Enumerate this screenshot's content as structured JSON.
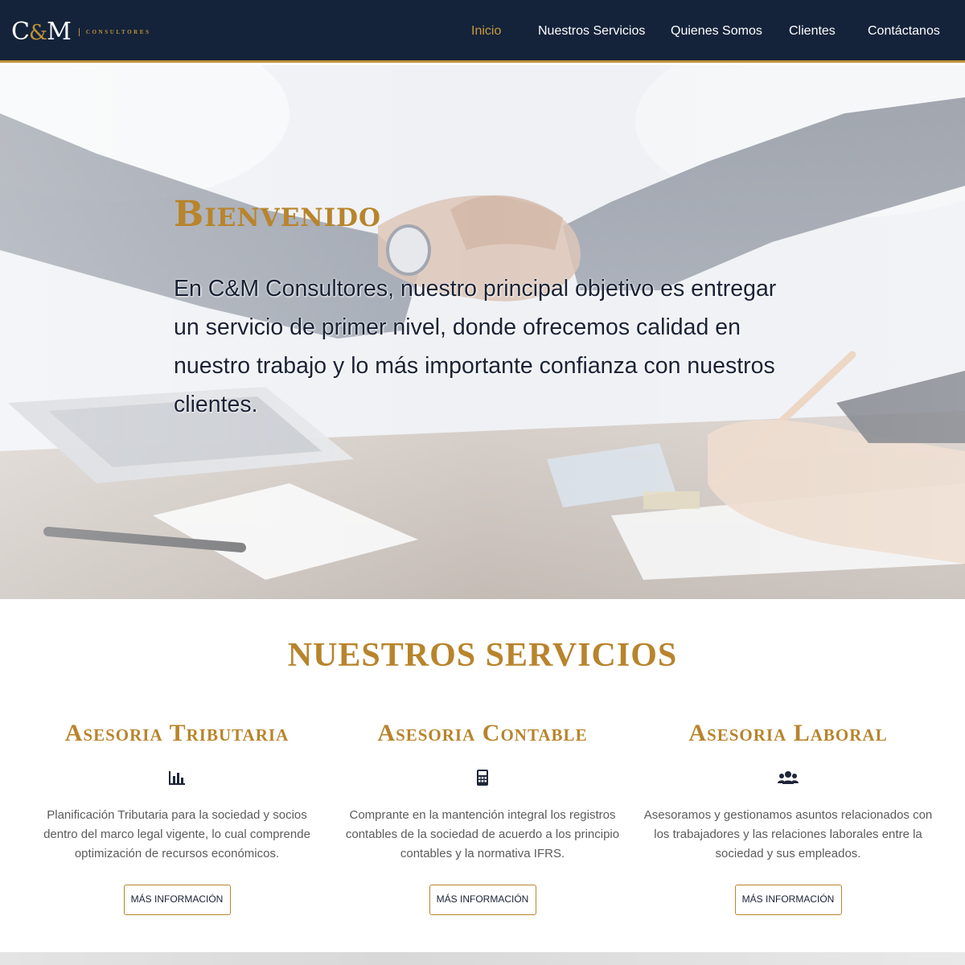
{
  "brand": {
    "mark_left": "C",
    "mark_amp": "&",
    "mark_right": "M",
    "subtitle": "CONSULTORES",
    "colors": {
      "navy": "#14233a",
      "gold": "#b8842c",
      "text": "#1a2235"
    }
  },
  "nav": {
    "items": [
      {
        "label": "Inicio",
        "active": true
      },
      {
        "label": "Nuestros Servicios",
        "active": false
      },
      {
        "label": "Quienes Somos",
        "active": false
      },
      {
        "label": "Clientes",
        "active": false
      },
      {
        "label": "Contáctanos",
        "active": false
      }
    ]
  },
  "hero": {
    "title": "Bienvenido",
    "text": "En C&M Consultores, nuestro principal objetivo es entregar un servicio de primer nivel, donde ofrecemos calidad en nuestro trabajo y lo más importante confianza con nuestros clientes."
  },
  "services": {
    "title": "NUESTROS SERVICIOS",
    "items": [
      {
        "heading": "Asesoria Tributaria",
        "icon": "bar-chart-icon",
        "description": "Planificación Tributaria para la sociedad y socios dentro del marco legal vigente, lo cual comprende optimización de recursos económicos.",
        "button": "MÁS INFORMACIÓN"
      },
      {
        "heading": "Asesoria Contable",
        "icon": "calculator-icon",
        "description": "Comprante en la mantención integral los registros contables de la sociedad de acuerdo a los principio contables y la normativa IFRS.",
        "button": "MÁS INFORMACIÓN"
      },
      {
        "heading": "Asesoria Laboral",
        "icon": "users-icon",
        "description": "Asesoramos y gestionamos asuntos relacionados con los trabajadores y las relaciones laborales entre la sociedad y sus empleados.",
        "button": "MÁS INFORMACIÓN"
      }
    ]
  }
}
